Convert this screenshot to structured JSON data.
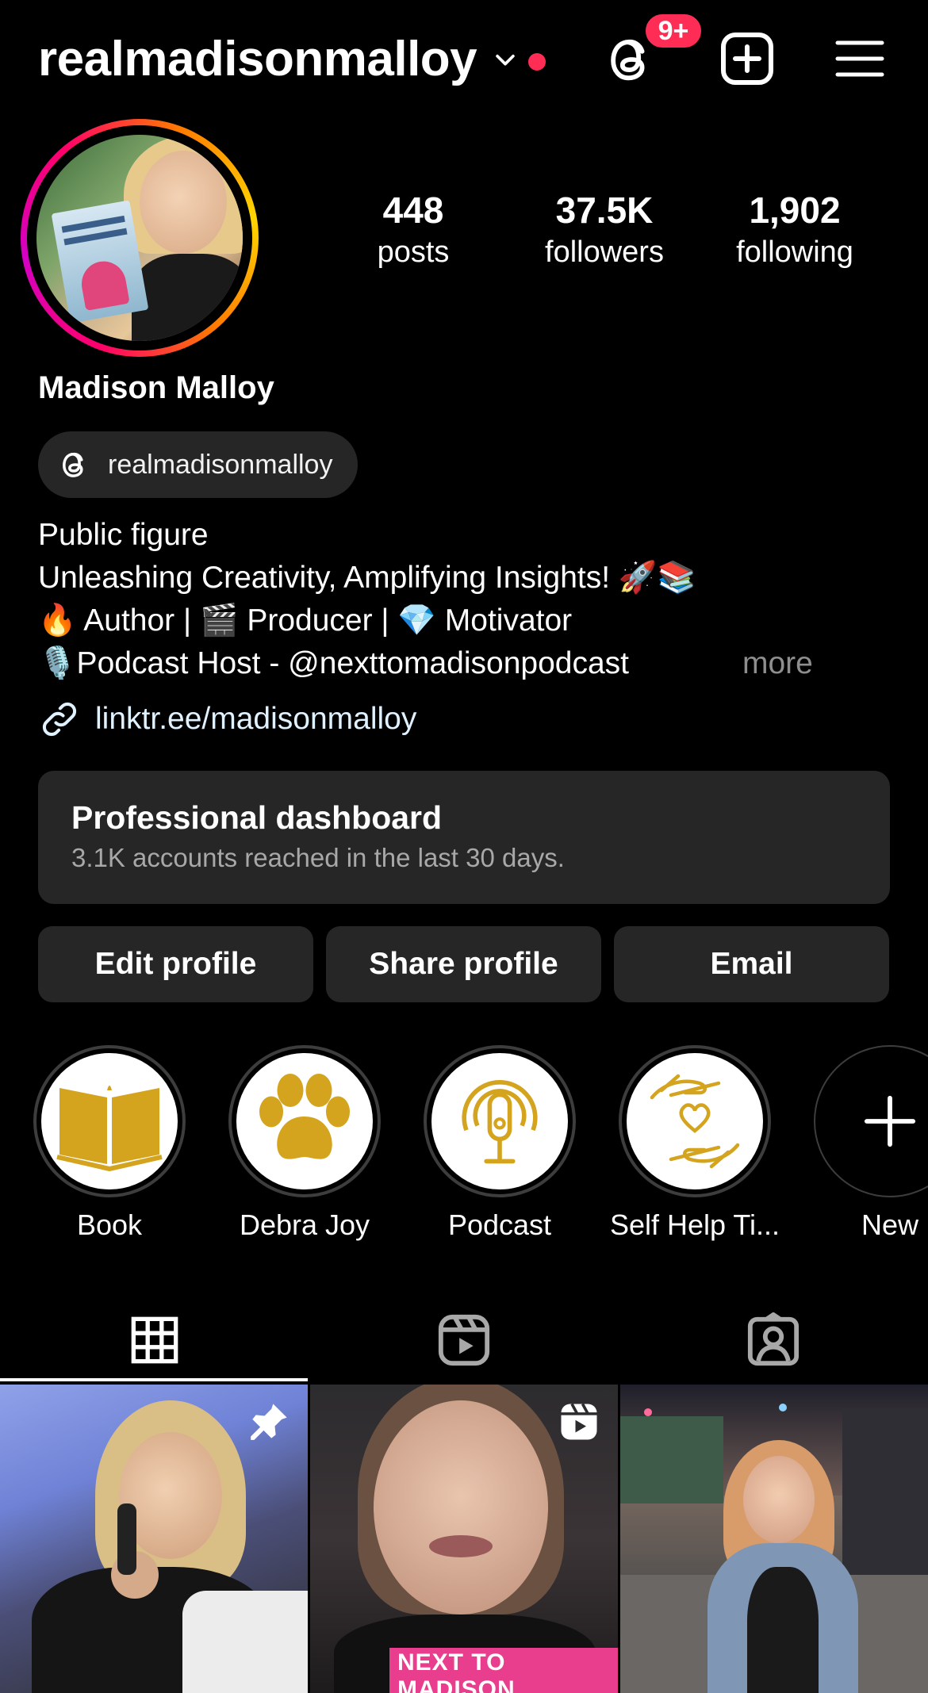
{
  "header": {
    "username": "realmadisonmalloy",
    "notification_badge": "9+",
    "accent_color": "#ff2d55"
  },
  "profile": {
    "stats": [
      {
        "value": "448",
        "label": "posts"
      },
      {
        "value": "37.5K",
        "label": "followers"
      },
      {
        "value": "1,902",
        "label": "following"
      }
    ],
    "full_name": "Madison Malloy",
    "threads_handle": "realmadisonmalloy",
    "bio": {
      "category": "Public figure",
      "line1": "Unleashing Creativity, Amplifying Insights! 🚀📚",
      "line2": "🔥 Author | 🎬 Producer | 💎 Motivator",
      "line3": "🎙️Podcast Host - @nexttomadisonpodcast",
      "more": "more"
    },
    "link": "linktr.ee/madisonmalloy"
  },
  "dashboard": {
    "title": "Professional dashboard",
    "subtitle": "3.1K accounts reached in the last 30 days."
  },
  "actions": {
    "edit": "Edit profile",
    "share": "Share profile",
    "email": "Email"
  },
  "highlights": [
    {
      "label": "Book",
      "icon": "book-icon"
    },
    {
      "label": "Debra Joy",
      "icon": "paw-icon"
    },
    {
      "label": "Podcast",
      "icon": "microphone-icon"
    },
    {
      "label": "Self Help Ti...",
      "icon": "hands-heart-icon"
    },
    {
      "label": "New",
      "icon": "plus-icon"
    }
  ],
  "tabs": [
    {
      "name": "grid",
      "icon": "grid-icon",
      "active": true
    },
    {
      "name": "reels",
      "icon": "reels-icon",
      "active": false
    },
    {
      "name": "tagged",
      "icon": "tagged-icon",
      "active": false
    }
  ],
  "posts": [
    {
      "type": "pinned-photo",
      "icon": "pin-icon"
    },
    {
      "type": "reel",
      "icon": "reels-icon",
      "badge_text": "NEXT TO MADISON"
    },
    {
      "type": "photo"
    }
  ],
  "highlight_color": "#d4a41e"
}
